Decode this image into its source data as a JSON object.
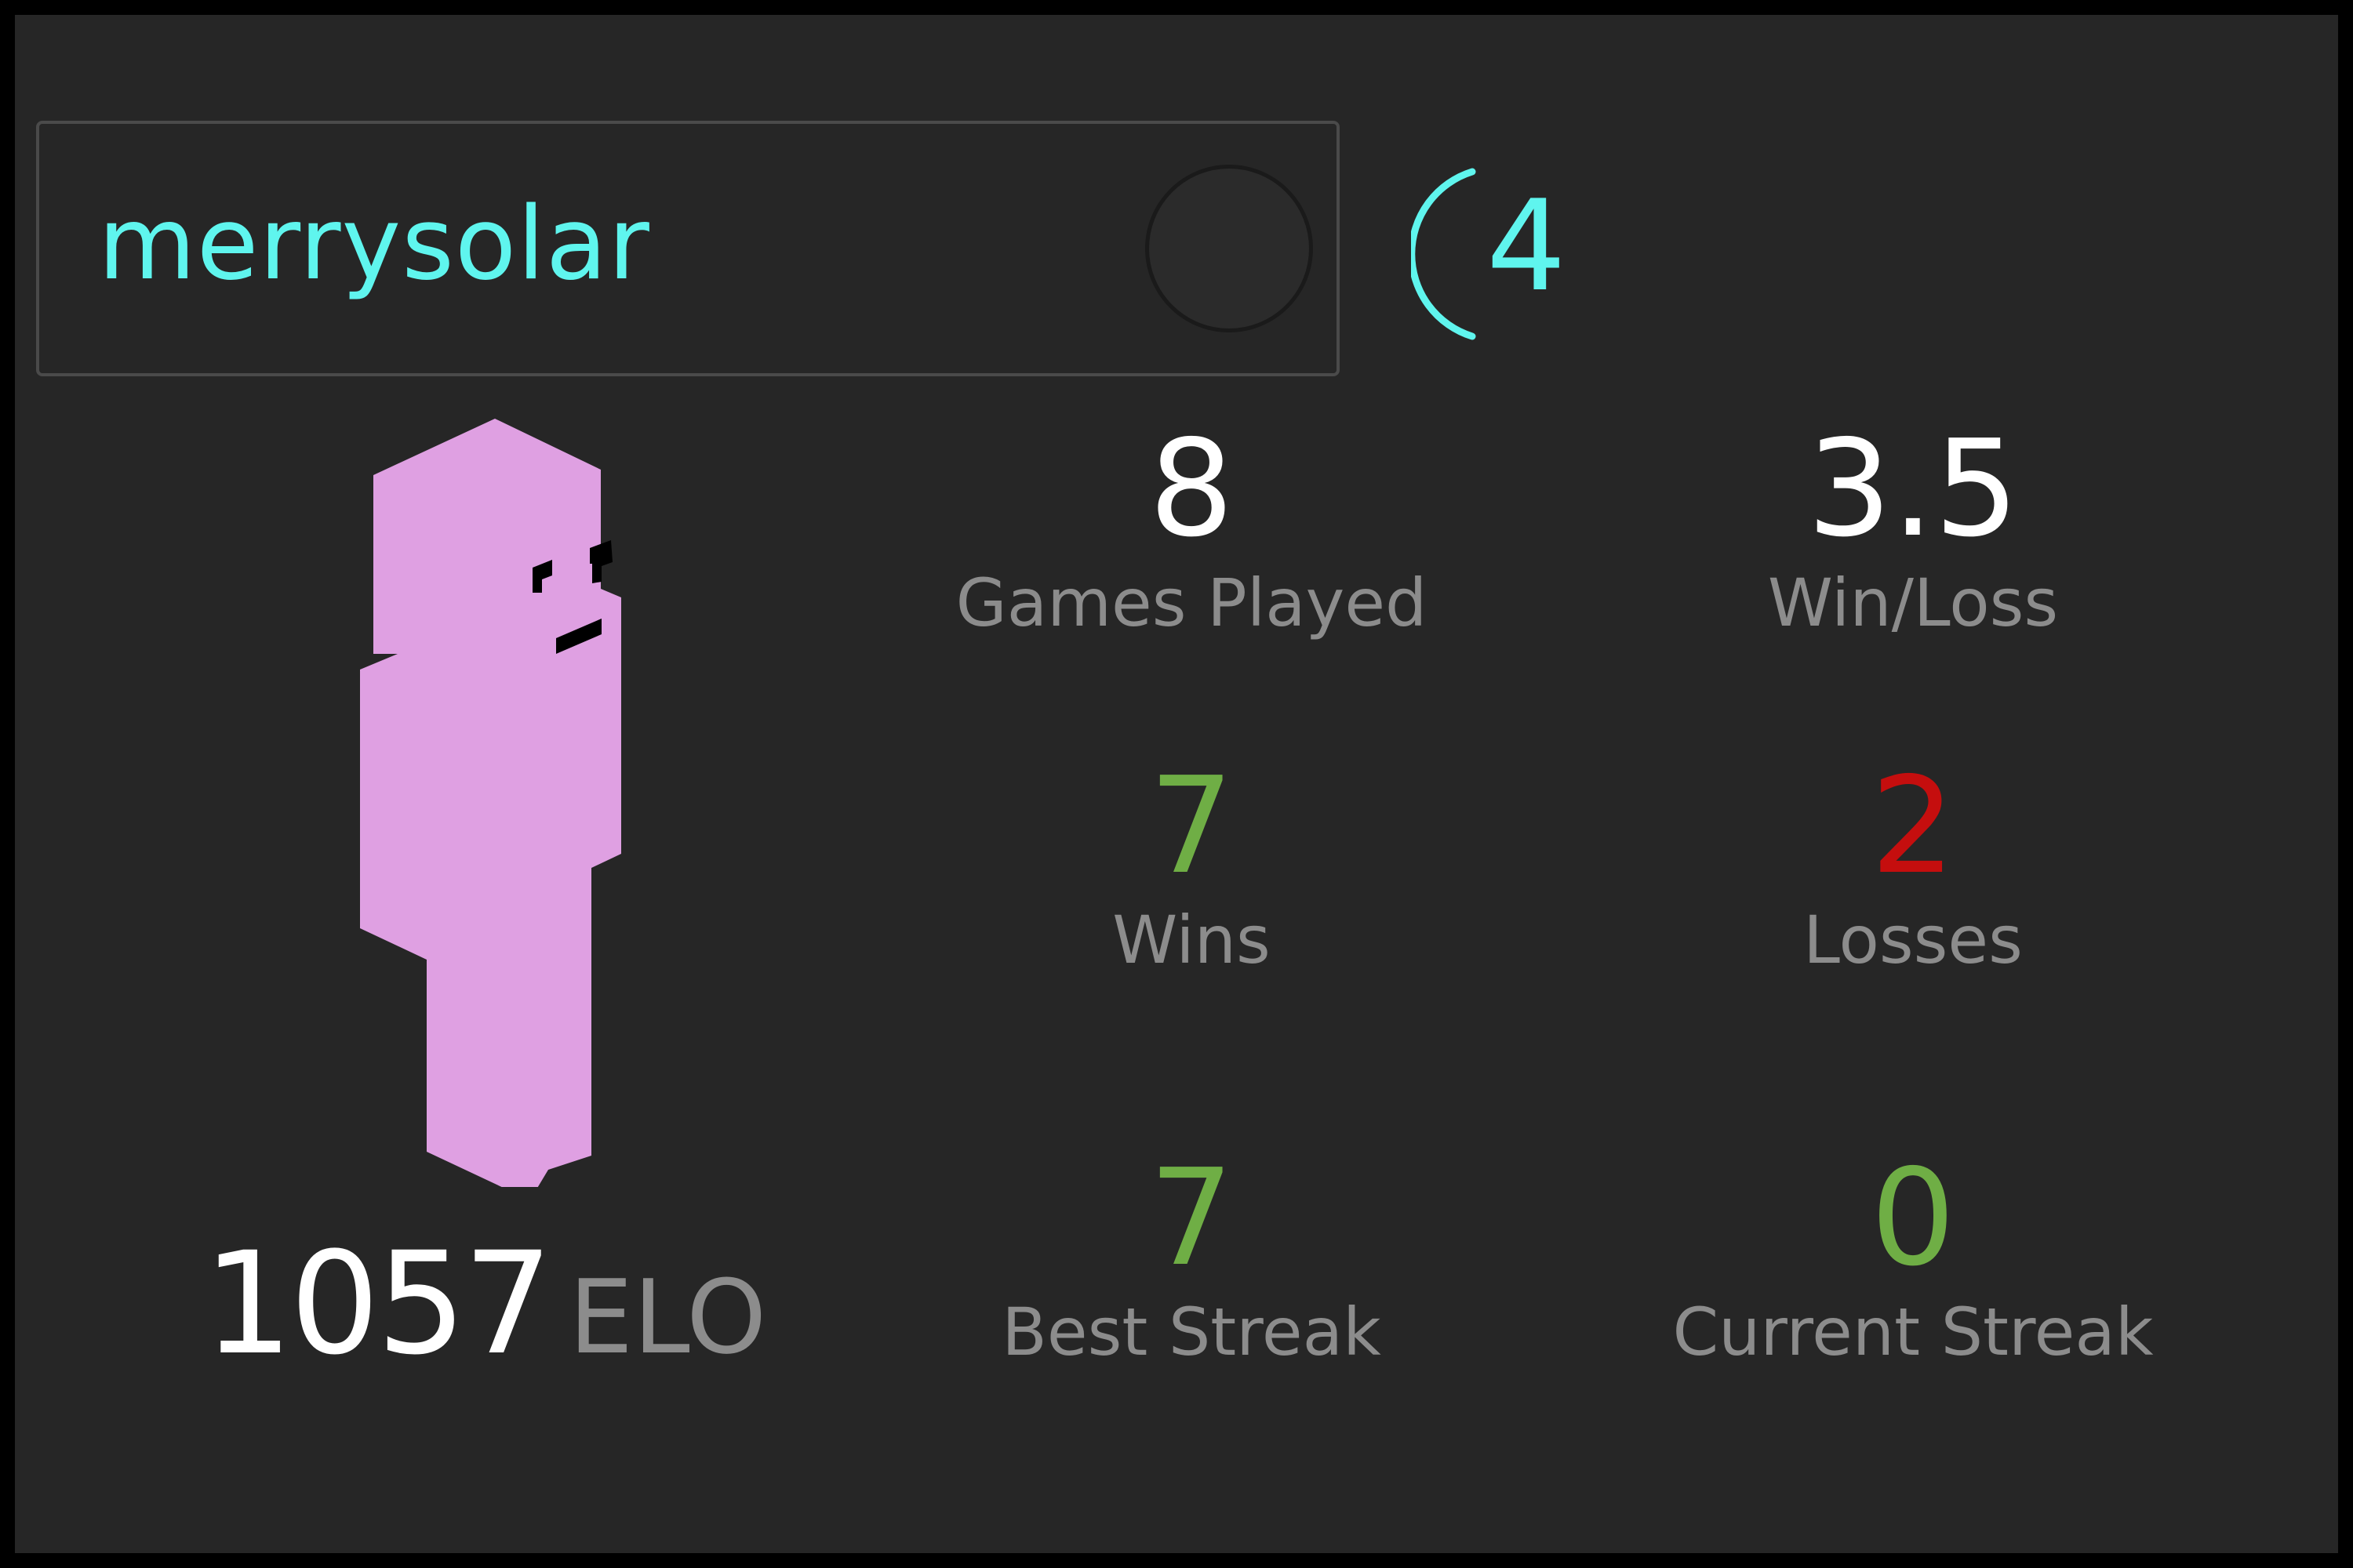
{
  "player": {
    "name": "merrysolar",
    "badge_value": "4",
    "elo_value": "1057",
    "elo_label": "ELO"
  },
  "stats": {
    "games_played": {
      "value": "8",
      "label": "Games Played"
    },
    "win_loss": {
      "value": "3.5",
      "label": "Win/Loss"
    },
    "wins": {
      "value": "7",
      "label": "Wins"
    },
    "losses": {
      "value": "2",
      "label": "Losses"
    },
    "best_streak": {
      "value": "7",
      "label": "Best Streak"
    },
    "current_streak": {
      "value": "0",
      "label": "Current Streak"
    }
  },
  "colors": {
    "background": "#262626",
    "name": "#5ff5ee",
    "positive": "#6fae45",
    "negative": "#c50e0e",
    "label": "#8c8c8c",
    "avatar": "#dfa0e2"
  }
}
